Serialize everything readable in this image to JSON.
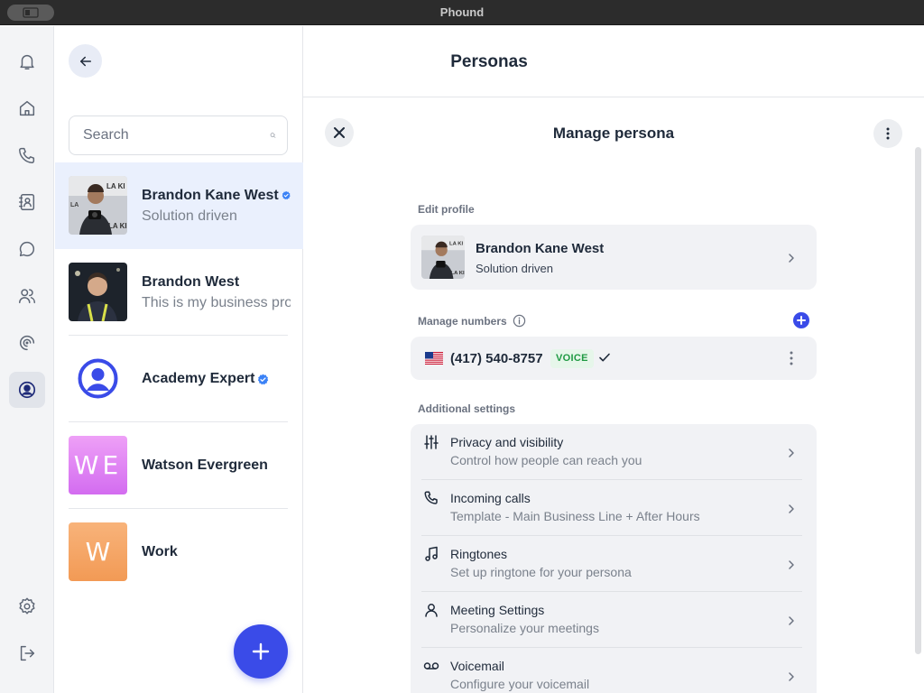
{
  "window": {
    "title": "Phound"
  },
  "header": {
    "title": "Personas"
  },
  "rail": {
    "items": [
      {
        "icon": "bell-icon",
        "label": "Notifications"
      },
      {
        "icon": "home-icon",
        "label": "Home"
      },
      {
        "icon": "phone-icon",
        "label": "Calls"
      },
      {
        "icon": "contacts-icon",
        "label": "Contacts"
      },
      {
        "icon": "chat-icon",
        "label": "Messages"
      },
      {
        "icon": "people-icon",
        "label": "Team"
      },
      {
        "icon": "spiral-icon",
        "label": "Activity"
      },
      {
        "icon": "persona-icon",
        "label": "Personas",
        "active": true
      }
    ],
    "bottom": [
      {
        "icon": "gear-icon",
        "label": "Settings"
      },
      {
        "icon": "logout-icon",
        "label": "Log out"
      }
    ]
  },
  "list": {
    "search_placeholder": "Search",
    "personas": [
      {
        "name": "Brandon Kane West",
        "subtitle": "Solution driven",
        "verified": true,
        "selected": true,
        "avatar": "photo-1"
      },
      {
        "name": "Brandon West",
        "subtitle": "This is my business profile",
        "verified": false,
        "avatar": "photo-2"
      },
      {
        "name": "Academy Expert",
        "subtitle": "",
        "verified": true,
        "avatar": "icon",
        "avatar_color": "#3a4be8"
      },
      {
        "name": "Watson Evergreen",
        "subtitle": "",
        "verified": false,
        "avatar": "initials",
        "initials": "WE",
        "avatar_color": "#d86bf2"
      },
      {
        "name": "Work",
        "subtitle": "",
        "verified": false,
        "avatar": "initials",
        "initials": "W",
        "avatar_color": "#f5a465"
      }
    ]
  },
  "manage": {
    "title": "Manage persona",
    "edit_profile_label": "Edit profile",
    "profile": {
      "name": "Brandon Kane West",
      "subtitle": "Solution driven"
    },
    "manage_numbers_label": "Manage numbers",
    "number": {
      "value": "(417) 540-8757",
      "badge": "VOICE",
      "flag": "us"
    },
    "additional_settings_label": "Additional settings",
    "settings": [
      {
        "icon": "sliders-icon",
        "title": "Privacy and visibility",
        "desc": "Control how people can reach you"
      },
      {
        "icon": "phone-icon",
        "title": "Incoming calls",
        "desc": "Template - Main Business Line + After Hours"
      },
      {
        "icon": "music-note-icon",
        "title": "Ringtones",
        "desc": "Set up ringtone for your persona"
      },
      {
        "icon": "person-icon",
        "title": "Meeting Settings",
        "desc": "Personalize your meetings"
      },
      {
        "icon": "voicemail-icon",
        "title": "Voicemail",
        "desc": "Configure your voicemail"
      }
    ]
  },
  "colors": {
    "accent": "#3a4be8",
    "selected_row": "#eaf0fd",
    "voice_badge_bg": "#e6f6ea",
    "voice_badge_fg": "#1f9a43"
  }
}
